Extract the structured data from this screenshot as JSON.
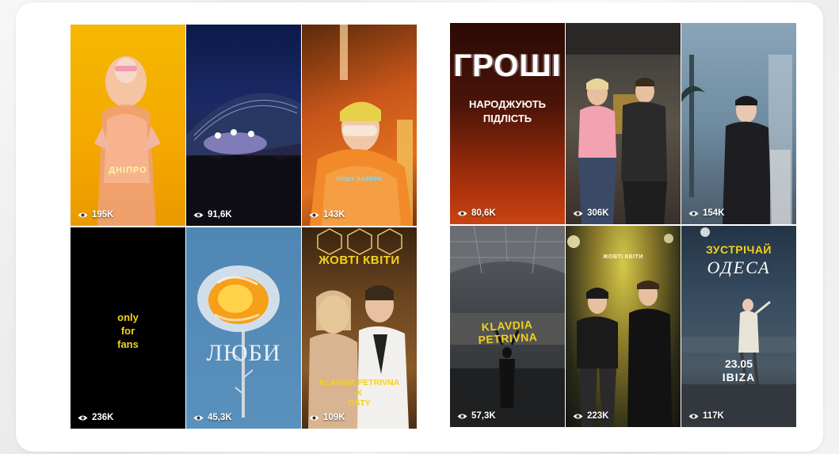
{
  "colors": {
    "page_bg": "#eeeeee",
    "card_bg": "#ffffff",
    "accent_yellow": "#f0c400"
  },
  "left_grid": [
    {
      "caption": "ДНІПРО",
      "views": "195K",
      "icon": "eye-icon"
    },
    {
      "views": "91,6K",
      "icon": "eye-icon"
    },
    {
      "caption": "ПИШУ КАВЕРИ",
      "views": "143K",
      "icon": "eye-icon"
    },
    {
      "caption_lines": [
        "only",
        "for",
        "fans"
      ],
      "views": "236K",
      "icon": "eye-icon"
    },
    {
      "caption": "ЛЮБИ",
      "views": "45,3K",
      "icon": "eye-icon"
    },
    {
      "title": "ЖОВТІ КВІТИ",
      "artists_line1": "KLAVDIA PETRIVNA",
      "artists_line2": "X",
      "artists_line3": "OSTY",
      "views": "109K",
      "icon": "eye-icon"
    }
  ],
  "right_grid": [
    {
      "title": "ГРОШІ",
      "subtitle_line1": "НАРОДЖУЮТЬ",
      "subtitle_line2": "ПІДЛІСТЬ",
      "views": "80,6K",
      "icon": "eye-icon"
    },
    {
      "views": "306K",
      "icon": "eye-icon"
    },
    {
      "views": "154K",
      "icon": "eye-icon"
    },
    {
      "caption": "KLAVDIA PETRIVNA",
      "views": "57,3K",
      "icon": "eye-icon"
    },
    {
      "caption": "ЖОВТІ КВІТИ",
      "views": "223K",
      "icon": "eye-icon"
    },
    {
      "title_line1": "ЗУСТРІЧАЙ",
      "title_line2": "ОДЕСА",
      "date": "23.05",
      "place": "IBIZA",
      "views": "117K",
      "icon": "eye-icon"
    }
  ]
}
